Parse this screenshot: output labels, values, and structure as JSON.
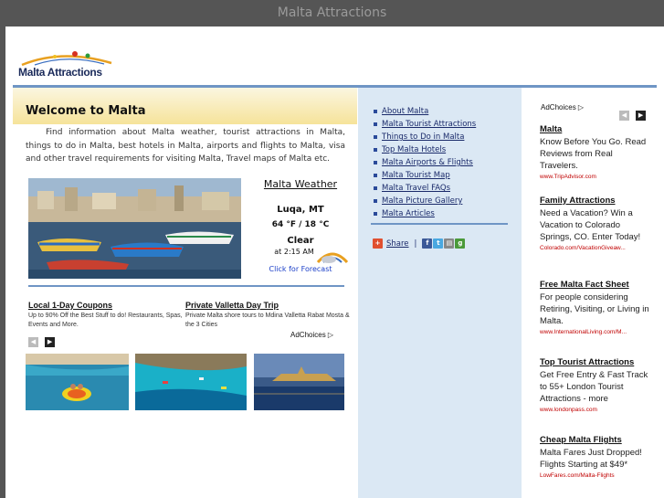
{
  "window": {
    "title": "Malta Attractions"
  },
  "logo": {
    "text": "Malta Attractions"
  },
  "welcome": {
    "title": "Welcome to Malta",
    "intro": "Find information about Malta weather, tourist attractions in Malta, things to do in Malta, best hotels in Malta, airports and flights to Malta, visa and other travel requirements for visiting Malta, Travel maps of Malta etc."
  },
  "weather": {
    "title": "Malta Weather",
    "location": "Luqa, MT",
    "temperature": "64 °F / 18 °C",
    "condition": "Clear",
    "time": "at 2:15 AM",
    "forecast_link": "Click for Forecast"
  },
  "left_ads": [
    {
      "title": "Local 1-Day Coupons",
      "text": "Up to 90% Off the Best Stuff to do! Restaurants, Spas, Events and More."
    },
    {
      "title": "Private Valletta Day Trip",
      "text": "Private Malta shore tours to Mdina Valletta Rabat Mosta & the 3 Cities"
    }
  ],
  "adchoices": "AdChoices",
  "nav_buttons": {
    "prev": "◀",
    "next": "▶"
  },
  "menu": [
    "About Malta",
    "Malta Tourist Attractions",
    "Things to Do in Malta",
    "Top Malta Hotels",
    "Malta Airports & Flights",
    "Malta Tourist Map",
    "Malta Travel FAQs",
    "Malta Picture Gallery",
    "Malta Articles"
  ],
  "share": {
    "label": "Share",
    "separator": "|"
  },
  "right_ads": [
    {
      "title": "Malta",
      "text": "Know Before You Go. Read Reviews from Real Travelers.",
      "url": "www.TripAdvisor.com"
    },
    {
      "title": "Family Attractions",
      "text": "Need a Vacation? Win a Vacation to Colorado Springs, CO. Enter Today!",
      "url": "Colorado.com/VacationGiveaw..."
    },
    {
      "title": "Free Malta Fact Sheet",
      "text": "For people considering Retiring, Visiting, or Living in Malta.",
      "url": "www.InternationalLiving.com/M..."
    },
    {
      "title": "Top Tourist Attractions",
      "text": "Get Free Entry & Fast Track to 55+ London Tourist Attractions - more",
      "url": "www.londonpass.com"
    },
    {
      "title": "Cheap Malta Flights",
      "text": "Malta Fares Just Dropped! Flights Starting at $49*",
      "url": "LowFares.com/Malta-Flights"
    }
  ],
  "colors": {
    "accent_rule": "#6f95c5",
    "side_panel": "#dbe8f4",
    "link": "#1a2a6a",
    "ad_url": "#c00000"
  }
}
